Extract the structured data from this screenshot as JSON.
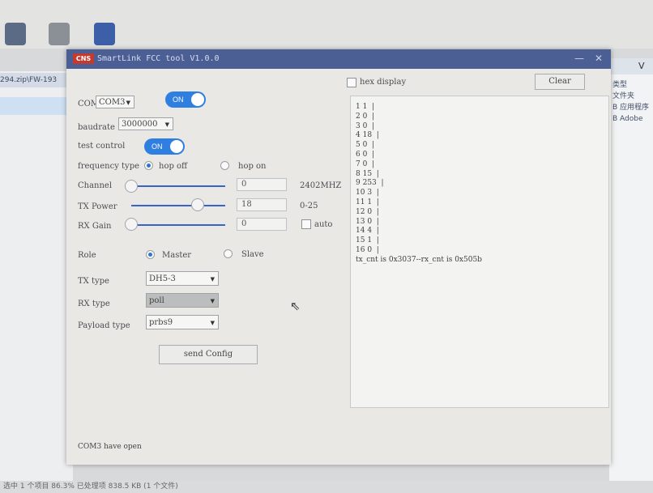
{
  "window": {
    "title": "SmartLink FCC tool V1.0.0",
    "logo_text": "CNS",
    "minimize_glyph": "—",
    "close_glyph": "✕"
  },
  "left": {
    "com_label": "COM",
    "com_value": "COM3",
    "com_toggle": "ON",
    "baudrate_label": "baudrate",
    "baudrate_value": "3000000",
    "test_control_label": "test control",
    "test_control_toggle": "ON",
    "frequency_type_label": "frequency type",
    "hop_off_label": "hop off",
    "hop_on_label": "hop on",
    "hop_selected": "hop off",
    "channel_label": "Channel",
    "channel_value": "0",
    "channel_unit": "2402MHZ",
    "channel_slider_fraction": 0,
    "tx_power_label": "TX Power",
    "tx_power_value": "18",
    "tx_power_range": "0-25",
    "tx_power_slider_fraction": 0.72,
    "rx_gain_label": "RX Gain",
    "rx_gain_value": "0",
    "rx_gain_slider_fraction": 0,
    "auto_label": "auto",
    "role_label": "Role",
    "master_label": "Master",
    "slave_label": "Slave",
    "role_selected": "Master",
    "tx_type_label": "TX type",
    "tx_type_value": "DH5-3",
    "rx_type_label": "RX type",
    "rx_type_value": "poll",
    "payload_type_label": "Payload type",
    "payload_type_value": "prbs9",
    "send_button": "send Config"
  },
  "right": {
    "hex_display_label": "hex display",
    "clear_button": "Clear",
    "output_lines": [
      "1 1  |",
      "2 0  |",
      "3 0  |",
      "4 18  |",
      "5 0  |",
      "6 0  |",
      "7 0  |",
      "8 15  |",
      "9 253  |",
      "10 3  |",
      "11 1  |",
      "12 0  |",
      "13 0  |",
      "14 4  |",
      "15 1  |",
      "16 0  |",
      "tx_cnt is 0x3037--rx_cnt is 0x505b"
    ]
  },
  "status": "COM3 have open",
  "desktop": {
    "left_path": "294.zip\\FW-193",
    "right_header": "V",
    "right_rows": [
      "类型",
      "文件夹",
      "B  应用程序",
      "B  Adobe"
    ],
    "os_status": "选中 1 个项目  86.3% 已处理项  838.5 KB (1 个文件)"
  },
  "colors": {
    "titlebar": "#4b5f94",
    "toggle_on": "#2f7fe0",
    "slider_track": "#3a63c8"
  }
}
